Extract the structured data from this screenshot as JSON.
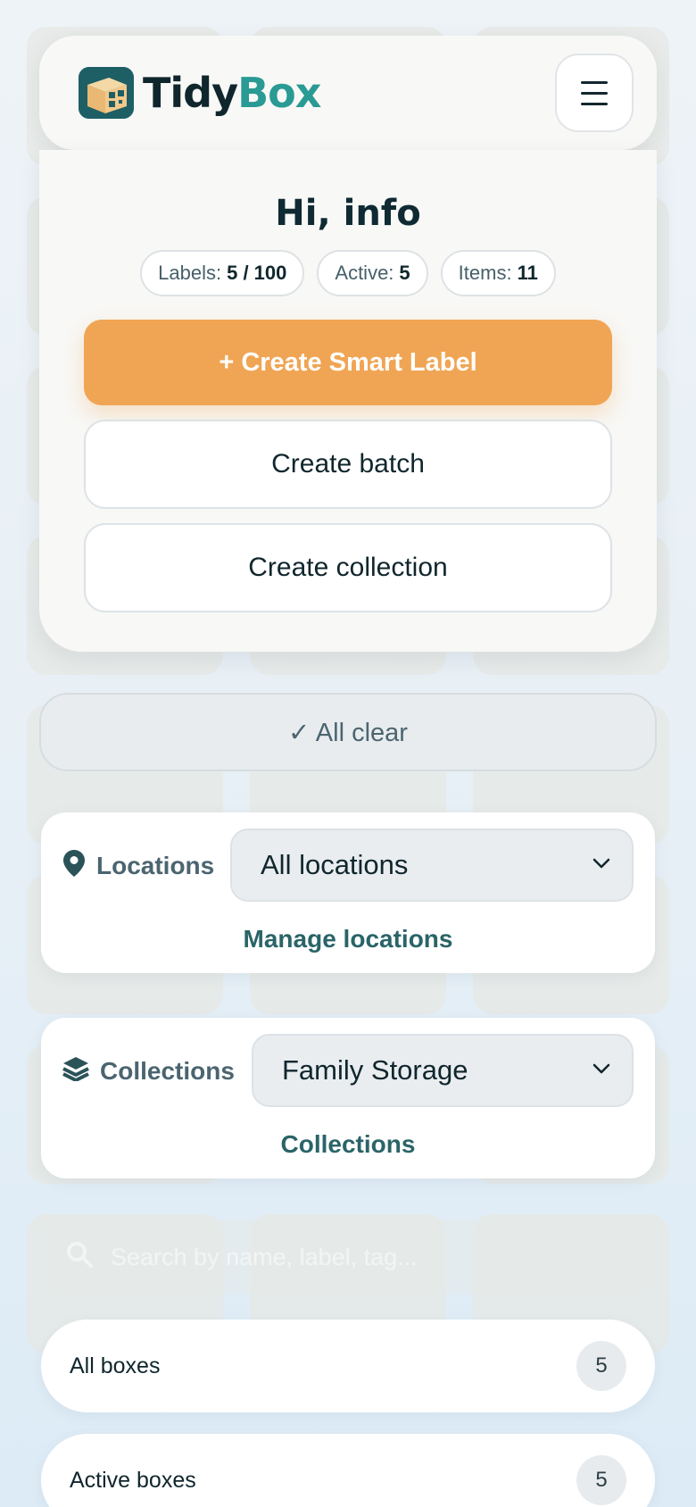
{
  "brand": {
    "part1": "Tidy",
    "part2": "Box",
    "logo_icon": "box-qr-icon"
  },
  "header": {
    "menu_icon": "hamburger-icon"
  },
  "hero": {
    "greeting": "Hi, info",
    "stats": [
      {
        "label": "Labels:",
        "value": "5 / 100"
      },
      {
        "label": "Active:",
        "value": "5"
      },
      {
        "label": "Items:",
        "value": "11"
      }
    ],
    "primary_action": "+ Create Smart Label",
    "batch_action": "Create batch",
    "collection_action": "Create collection"
  },
  "status": {
    "text": "✓ All clear"
  },
  "locations": {
    "label": "Locations",
    "icon": "map-pin-icon",
    "selected": "All locations",
    "link": "Manage locations"
  },
  "collections": {
    "label": "Collections",
    "icon": "layers-icon",
    "selected": "Family Storage",
    "link": "Collections"
  },
  "search": {
    "placeholder": "Search by name, label, tag..."
  },
  "lists": [
    {
      "label": "All boxes",
      "count": "5"
    },
    {
      "label": "Active boxes",
      "count": "5"
    }
  ],
  "colors": {
    "accent": "#f0a554",
    "brand_teal": "#2a9a94",
    "link": "#2a6468",
    "dark": "#10262d"
  }
}
